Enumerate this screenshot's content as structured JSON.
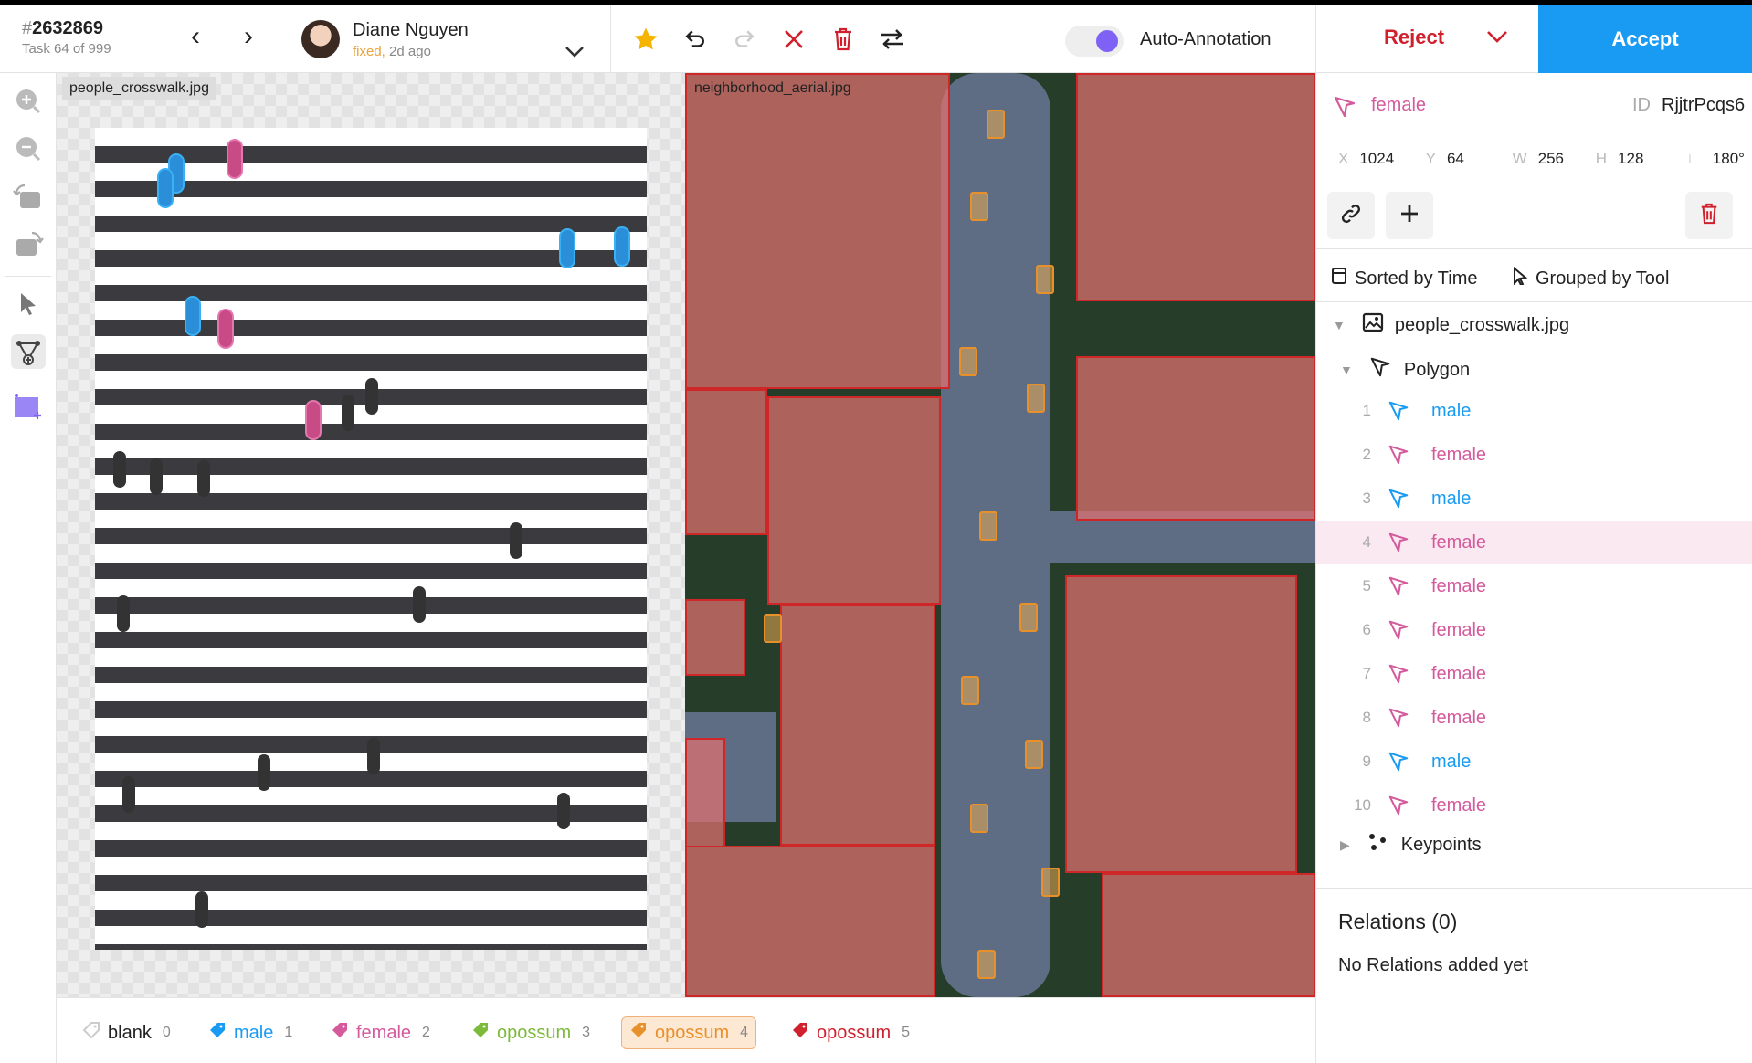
{
  "header": {
    "task_hash": "#",
    "task_number": "2632869",
    "task_sub": "Task 64 of 999",
    "user_name": "Diane Nguyen",
    "user_status_fixed": "fixed,",
    "user_status_time": " 2d ago",
    "auto_annotation_label": "Auto-Annotation",
    "reject_label": "Reject",
    "accept_label": "Accept"
  },
  "canvas": {
    "left_image_name": "people_crosswalk.jpg",
    "right_image_name": "neighborhood_aerial.jpg"
  },
  "labels": [
    {
      "name": "blank",
      "count": "0",
      "color": "#cccccc"
    },
    {
      "name": "male",
      "count": "1",
      "color": "#1a9bf3"
    },
    {
      "name": "female",
      "count": "2",
      "color": "#d45a9c"
    },
    {
      "name": "opossum",
      "count": "3",
      "color": "#7cba3a"
    },
    {
      "name": "opossum",
      "count": "4",
      "color": "#e8902a"
    },
    {
      "name": "opossum",
      "count": "5",
      "color": "#d0202e"
    }
  ],
  "region": {
    "label": "female",
    "id_key": "ID",
    "id": "RjjtrPcqs6",
    "x_key": "X",
    "x": "1024",
    "y_key": "Y",
    "y": "64",
    "w_key": "W",
    "w": "256",
    "h_key": "H",
    "h": "128",
    "angle_key": "∟",
    "angle": "180°"
  },
  "outliner": {
    "sort_label": "Sorted by Time",
    "group_label": "Grouped by Tool",
    "file_name": "people_crosswalk.jpg",
    "group_name": "Polygon",
    "items": [
      {
        "num": "1",
        "label": "male"
      },
      {
        "num": "2",
        "label": "female"
      },
      {
        "num": "3",
        "label": "male"
      },
      {
        "num": "4",
        "label": "female"
      },
      {
        "num": "5",
        "label": "female"
      },
      {
        "num": "6",
        "label": "female"
      },
      {
        "num": "7",
        "label": "female"
      },
      {
        "num": "8",
        "label": "female"
      },
      {
        "num": "9",
        "label": "male"
      },
      {
        "num": "10",
        "label": "female"
      }
    ],
    "keypoints_label": "Keypoints"
  },
  "relations": {
    "title": "Relations (0)",
    "empty": "No Relations added yet"
  },
  "colors": {
    "accept": "#1a9bf3",
    "reject": "#d0202e",
    "male": "#1a9bf3",
    "female": "#d45a9c",
    "highlight_row": "#fbe9f1"
  }
}
